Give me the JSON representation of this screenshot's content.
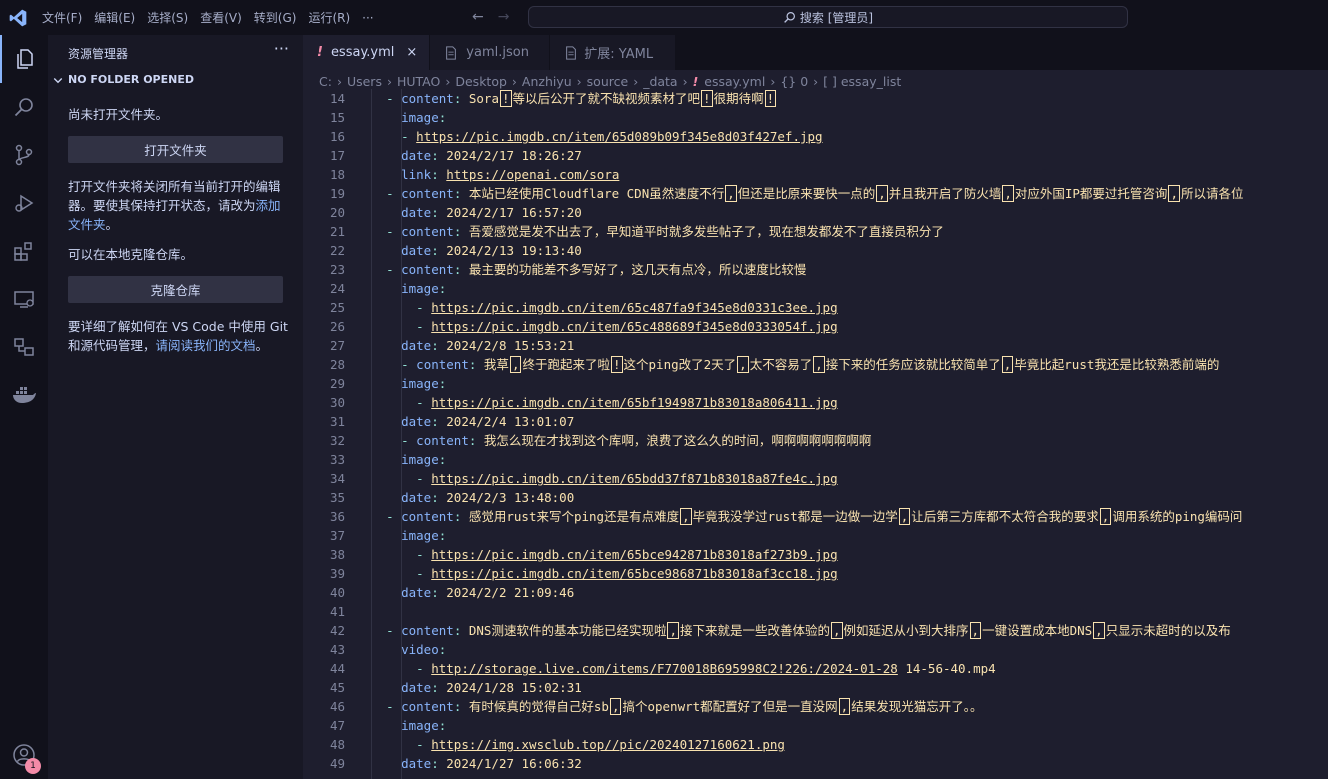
{
  "menu": {
    "items": [
      "文件(F)",
      "编辑(E)",
      "选择(S)",
      "查看(V)",
      "转到(G)",
      "运行(R)",
      "···"
    ]
  },
  "search": {
    "text": "搜索 [管理员]"
  },
  "sidebar": {
    "title": "资源管理器",
    "more": "···",
    "section": "NO FOLDER OPENED",
    "no_folder_text": "尚未打开文件夹。",
    "open_folder_button": "打开文件夹",
    "info_text": "打开文件夹将关闭所有当前打开的编辑器。要使其保持打开状态，请改为",
    "add_folder_link": "添加文件夹",
    "info_end": "。",
    "clone_text": "可以在本地克隆仓库。",
    "clone_button": "克隆仓库",
    "learn_text": "要详细了解如何在 VS Code 中使用 Git 和源代码管理，",
    "docs_link": "请阅读我们的文档",
    "learn_end": "。"
  },
  "account_badge": "1",
  "tabs": [
    {
      "icon": "!",
      "label": "essay.yml",
      "close": "×",
      "active": true
    },
    {
      "icon": "",
      "label": "yaml.json",
      "active": false
    },
    {
      "icon": "",
      "label": "扩展: YAML",
      "active": false
    }
  ],
  "breadcrumb": [
    "C:",
    "Users",
    "HUTAO",
    "Desktop",
    "Anzhiyu",
    "source",
    "_data",
    "essay.yml",
    "{} 0",
    "[ ] essay_list"
  ],
  "colors": {
    "background": "#1e1e2e",
    "accent": "#89b4fa",
    "string": "#f9e2af"
  },
  "editor": {
    "lines": [
      {
        "n": "14",
        "i": "  ",
        "d": "- ",
        "k": "content",
        "v": "Sora|!|等以后公开了就不缺视频素材了吧|!|很期待啊|!|"
      },
      {
        "n": "15",
        "i": "    ",
        "d": "",
        "k": "image",
        "v": ""
      },
      {
        "n": "16",
        "i": "    ",
        "d": "- ",
        "k": "",
        "u": "https://pic.imgdb.cn/item/65d089b09f345e8d03f427ef.jpg"
      },
      {
        "n": "17",
        "i": "    ",
        "d": "",
        "k": "date",
        "v": "2024/2/17 18:26:27"
      },
      {
        "n": "18",
        "i": "    ",
        "d": "",
        "k": "link",
        "u": "https://openai.com/sora"
      },
      {
        "n": "19",
        "i": "  ",
        "d": "- ",
        "k": "content",
        "v": "本站已经使用Cloudflare CDN虽然速度不行|,|但还是比原来要快一点的|,|并且我开启了防火墙|,|对应外国IP都要过托管咨询|,|所以请各位"
      },
      {
        "n": "20",
        "i": "    ",
        "d": "",
        "k": "date",
        "v": "2024/2/17 16:57:20"
      },
      {
        "n": "21",
        "i": "  ",
        "d": "- ",
        "k": "content",
        "v": "吾爱感觉是发不出去了，早知道平时就多发些帖子了，现在想发都发不了直接员积分了"
      },
      {
        "n": "22",
        "i": "    ",
        "d": "",
        "k": "date",
        "v": "2024/2/13 19:13:40"
      },
      {
        "n": "23",
        "i": "  ",
        "d": "- ",
        "k": "content",
        "v": "最主要的功能差不多写好了，这几天有点冷，所以速度比较慢"
      },
      {
        "n": "24",
        "i": "    ",
        "d": "",
        "k": "image",
        "v": ""
      },
      {
        "n": "25",
        "i": "      ",
        "d": "- ",
        "k": "",
        "u": "https://pic.imgdb.cn/item/65c487fa9f345e8d0331c3ee.jpg"
      },
      {
        "n": "26",
        "i": "      ",
        "d": "- ",
        "k": "",
        "u": "https://pic.imgdb.cn/item/65c488689f345e8d0333054f.jpg"
      },
      {
        "n": "27",
        "i": "    ",
        "d": "",
        "k": "date",
        "v": "2024/2/8 15:53:21"
      },
      {
        "n": "28",
        "i": "    ",
        "d": "- ",
        "k": "content",
        "v": "我草|,|终于跑起来了啦|!|这个ping改了2天了|,|太不容易了|,|接下来的任务应该就比较简单了|,|毕竟比起rust我还是比较熟悉前端的"
      },
      {
        "n": "29",
        "i": "    ",
        "d": "",
        "k": "image",
        "v": ""
      },
      {
        "n": "30",
        "i": "      ",
        "d": "- ",
        "k": "",
        "u": "https://pic.imgdb.cn/item/65bf1949871b83018a806411.jpg"
      },
      {
        "n": "31",
        "i": "    ",
        "d": "",
        "k": "date",
        "v": "2024/2/4 13:01:07"
      },
      {
        "n": "32",
        "i": "    ",
        "d": "- ",
        "k": "content",
        "v": "我怎么现在才找到这个库啊，浪费了这么久的时间，啊啊啊啊啊啊啊啊"
      },
      {
        "n": "33",
        "i": "    ",
        "d": "",
        "k": "image",
        "v": ""
      },
      {
        "n": "34",
        "i": "      ",
        "d": "- ",
        "k": "",
        "u": "https://pic.imgdb.cn/item/65bdd37f871b83018a87fe4c.jpg"
      },
      {
        "n": "35",
        "i": "    ",
        "d": "",
        "k": "date",
        "v": "2024/2/3 13:48:00"
      },
      {
        "n": "36",
        "i": "  ",
        "d": "- ",
        "k": "content",
        "v": "感觉用rust来写个ping还是有点难度|,|毕竟我没学过rust都是一边做一边学|,|让后第三方库都不太符合我的要求|,|调用系统的ping编码问"
      },
      {
        "n": "37",
        "i": "    ",
        "d": "",
        "k": "image",
        "v": ""
      },
      {
        "n": "38",
        "i": "      ",
        "d": "- ",
        "k": "",
        "u": "https://pic.imgdb.cn/item/65bce942871b83018af273b9.jpg"
      },
      {
        "n": "39",
        "i": "      ",
        "d": "- ",
        "k": "",
        "u": "https://pic.imgdb.cn/item/65bce986871b83018af3cc18.jpg"
      },
      {
        "n": "40",
        "i": "    ",
        "d": "",
        "k": "date",
        "v": "2024/2/2 21:09:46"
      },
      {
        "n": "41",
        "i": "",
        "d": "",
        "k": "",
        "v": ""
      },
      {
        "n": "42",
        "i": "  ",
        "d": "- ",
        "k": "content",
        "v": "DNS测速软件的基本功能已经实现啦|,|接下来就是一些改善体验的|,|例如延迟从小到大排序|,|一键设置成本地DNS|,|只显示未超时的以及布"
      },
      {
        "n": "43",
        "i": "    ",
        "d": "",
        "k": "video",
        "v": ""
      },
      {
        "n": "44",
        "i": "      ",
        "d": "- ",
        "k": "",
        "u": "http://storage.live.com/items/F770018B695998C2!226:/2024-01-28",
        "t": " 14-56-40.mp4"
      },
      {
        "n": "45",
        "i": "    ",
        "d": "",
        "k": "date",
        "v": "2024/1/28 15:02:31"
      },
      {
        "n": "46",
        "i": "  ",
        "d": "- ",
        "k": "content",
        "v": "有时候真的觉得自己好sb|,|搞个openwrt都配置好了但是一直没网|,|结果发现光猫忘开了。。"
      },
      {
        "n": "47",
        "i": "    ",
        "d": "",
        "k": "image",
        "v": ""
      },
      {
        "n": "48",
        "i": "      ",
        "d": "- ",
        "k": "",
        "u": "https://img.xwsclub.top//pic/20240127160621.png"
      },
      {
        "n": "49",
        "i": "    ",
        "d": "",
        "k": "date",
        "v": "2024/1/27 16:06:32"
      }
    ]
  }
}
